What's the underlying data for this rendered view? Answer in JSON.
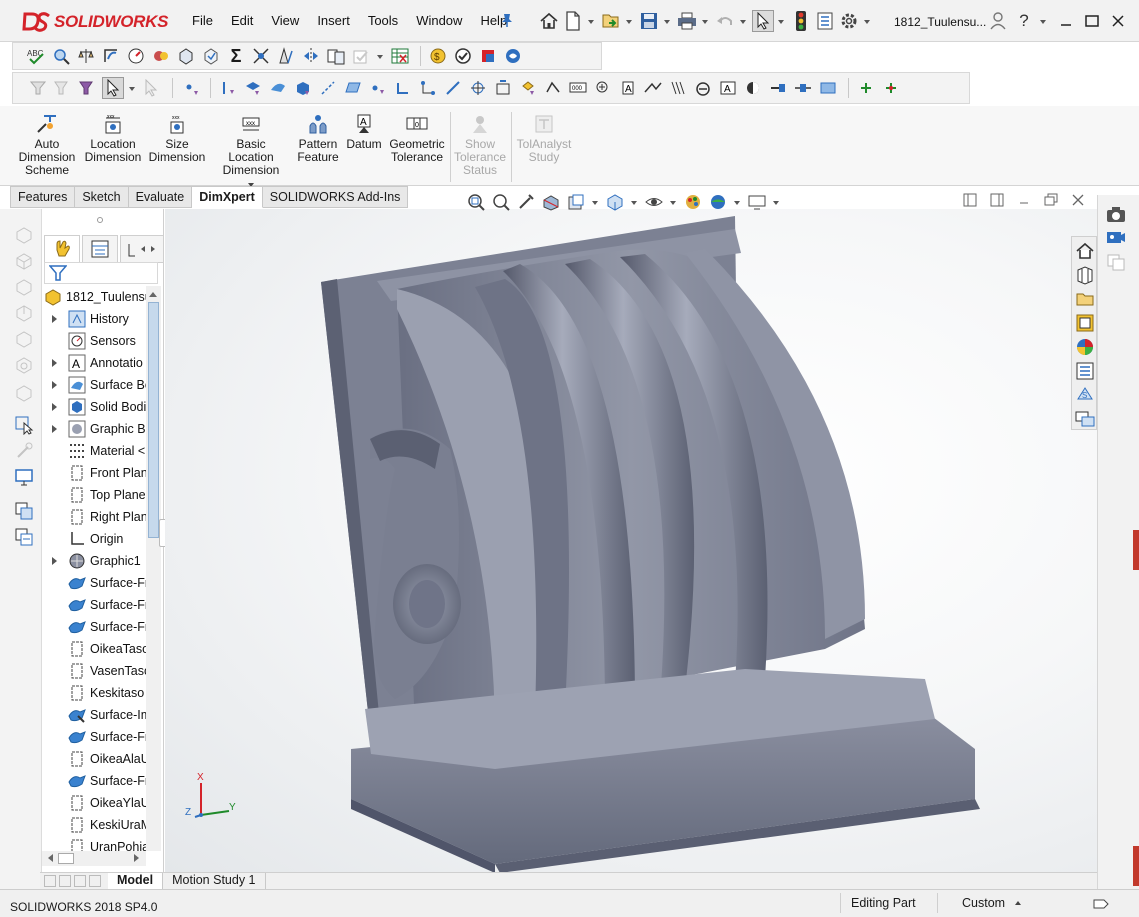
{
  "app": {
    "brand": "SOLIDWORKS",
    "document_title": "1812_Tuulensu...",
    "menus": [
      "File",
      "Edit",
      "View",
      "Insert",
      "Tools",
      "Window",
      "Help"
    ]
  },
  "command_manager": {
    "buttons": [
      {
        "label_lines": [
          "Auto",
          "Dimension",
          "Scheme"
        ],
        "icon": "auto-dimension-scheme-icon",
        "enabled": true
      },
      {
        "label_lines": [
          "Location",
          "Dimension"
        ],
        "icon": "location-dimension-icon",
        "enabled": true
      },
      {
        "label_lines": [
          "Size",
          "Dimension"
        ],
        "icon": "size-dimension-icon",
        "enabled": true
      },
      {
        "label_lines": [
          "Basic Location",
          "Dimension"
        ],
        "icon": "basic-location-dimension-icon",
        "enabled": true
      },
      {
        "label_lines": [
          "Pattern",
          "Feature"
        ],
        "icon": "pattern-feature-icon",
        "enabled": true
      },
      {
        "label_lines": [
          "Datum"
        ],
        "icon": "datum-icon",
        "enabled": true
      },
      {
        "label_lines": [
          "Geometric",
          "Tolerance"
        ],
        "icon": "geometric-tolerance-icon",
        "enabled": true
      },
      {
        "label_lines": [
          "Show",
          "Tolerance",
          "Status"
        ],
        "icon": "show-tolerance-status-icon",
        "enabled": false
      },
      {
        "label_lines": [
          "TolAnalyst",
          "Study"
        ],
        "icon": "tolanalyst-study-icon",
        "enabled": false
      }
    ]
  },
  "tabs": [
    "Features",
    "Sketch",
    "Evaluate",
    "DimXpert",
    "SOLIDWORKS Add-Ins"
  ],
  "active_tab": "DimXpert",
  "feature_tree": {
    "root": "1812_Tuulensu",
    "items": [
      {
        "label": "History",
        "icon": "history-icon",
        "expandable": true
      },
      {
        "label": "Sensors",
        "icon": "sensors-icon",
        "expandable": false
      },
      {
        "label": "Annotatio",
        "icon": "annotations-icon",
        "expandable": true
      },
      {
        "label": "Surface Bc",
        "icon": "surface-bodies-icon",
        "expandable": true
      },
      {
        "label": "Solid Bodi",
        "icon": "solid-bodies-icon",
        "expandable": true
      },
      {
        "label": "Graphic Bc",
        "icon": "graphic-bodies-icon",
        "expandable": true
      },
      {
        "label": "Material <",
        "icon": "material-icon",
        "expandable": false
      },
      {
        "label": "Front Plan",
        "icon": "plane-icon",
        "expandable": false
      },
      {
        "label": "Top Plane",
        "icon": "plane-icon",
        "expandable": false
      },
      {
        "label": "Right Plan",
        "icon": "plane-icon",
        "expandable": false
      },
      {
        "label": "Origin",
        "icon": "origin-icon",
        "expandable": false
      },
      {
        "label": "Graphic1",
        "icon": "graphic-body-icon",
        "expandable": true
      },
      {
        "label": "Surface-Fr",
        "icon": "surface-feature-icon",
        "expandable": false
      },
      {
        "label": "Surface-Fr",
        "icon": "surface-feature-icon",
        "expandable": false
      },
      {
        "label": "Surface-Fr",
        "icon": "surface-feature-icon",
        "expandable": false
      },
      {
        "label": "OikeaTaso",
        "icon": "plane-icon",
        "expandable": false
      },
      {
        "label": "VasenTasc",
        "icon": "plane-icon",
        "expandable": false
      },
      {
        "label": "Keskitaso",
        "icon": "plane-icon",
        "expandable": false
      },
      {
        "label": "Surface-Im",
        "icon": "surface-import-icon",
        "expandable": false
      },
      {
        "label": "Surface-Fr",
        "icon": "surface-feature-icon",
        "expandable": false
      },
      {
        "label": "OikeaAlaU",
        "icon": "plane-icon",
        "expandable": false
      },
      {
        "label": "Surface-Fr",
        "icon": "surface-feature-icon",
        "expandable": false
      },
      {
        "label": "OikeaYlaU",
        "icon": "plane-icon",
        "expandable": false
      },
      {
        "label": "KeskiUraM",
        "icon": "plane-icon",
        "expandable": false
      },
      {
        "label": "UranPohia",
        "icon": "plane-icon",
        "expandable": false
      }
    ]
  },
  "triad": {
    "x": "X",
    "y": "Y",
    "z": "Z"
  },
  "bottom_tabs": [
    "Model",
    "Motion Study 1"
  ],
  "active_bottom_tab": "Model",
  "status_bar": {
    "version": "SOLIDWORKS 2018 SP4.0",
    "mode": "Editing Part",
    "units": "Custom"
  },
  "colors": {
    "brand_red": "#d4232a",
    "model_gray": "#7d8293",
    "background": "#f6f7f8",
    "accent_blue": "#2f6fbf"
  }
}
